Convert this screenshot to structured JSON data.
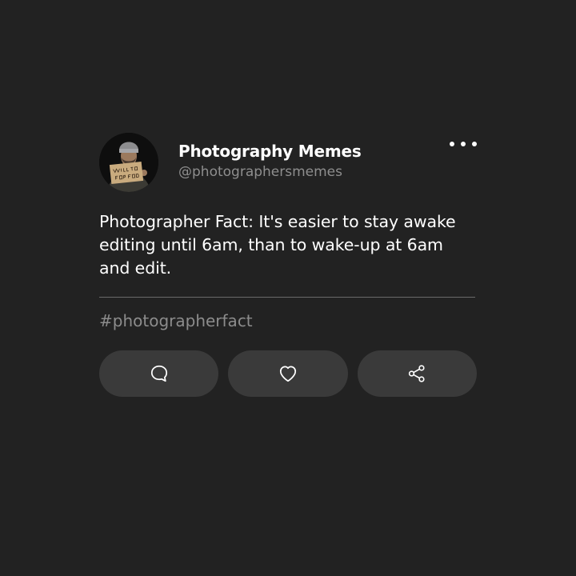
{
  "profile": {
    "display_name": "Photography Memes",
    "handle": "@photographersmemes",
    "avatar_sign_text": "WILL SHOOT FOR FOOD"
  },
  "post": {
    "text": "Photographer Fact: It's easier to stay awake editing until 6am, than to wake-up at 6am and edit.",
    "hashtag": "#photographerfact"
  },
  "icons": {
    "more": "more-horizontal-icon",
    "comment": "comment-icon",
    "like": "heart-icon",
    "share": "share-icon"
  },
  "colors": {
    "background": "#222222",
    "button": "#3a3a3a",
    "muted_text": "#8e8e8e",
    "divider": "#6a6a6a"
  }
}
